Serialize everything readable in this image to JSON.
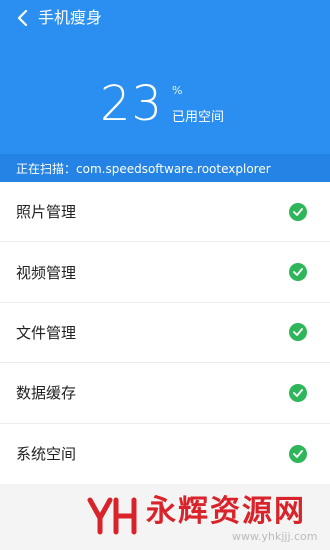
{
  "header": {
    "title": "手机瘦身",
    "percent": "23",
    "percent_sign": "%",
    "used_label": "已用空间",
    "scan_text": "正在扫描：com.speedsoftware.rootexplorer",
    "bg_color": "#2a8ff0",
    "scanbar_color": "#2483e4"
  },
  "list": {
    "check_color": "#2fb65a",
    "items": [
      {
        "label": "照片管理",
        "status": "done"
      },
      {
        "label": "视频管理",
        "status": "done"
      },
      {
        "label": "文件管理",
        "status": "done"
      },
      {
        "label": "数据缓存",
        "status": "done"
      },
      {
        "label": "系统空间",
        "status": "done"
      }
    ]
  },
  "watermark": {
    "logo_text": "YH",
    "text": "永辉资源网",
    "url": "www.yhkjjj.com",
    "color": "#d9232a"
  }
}
